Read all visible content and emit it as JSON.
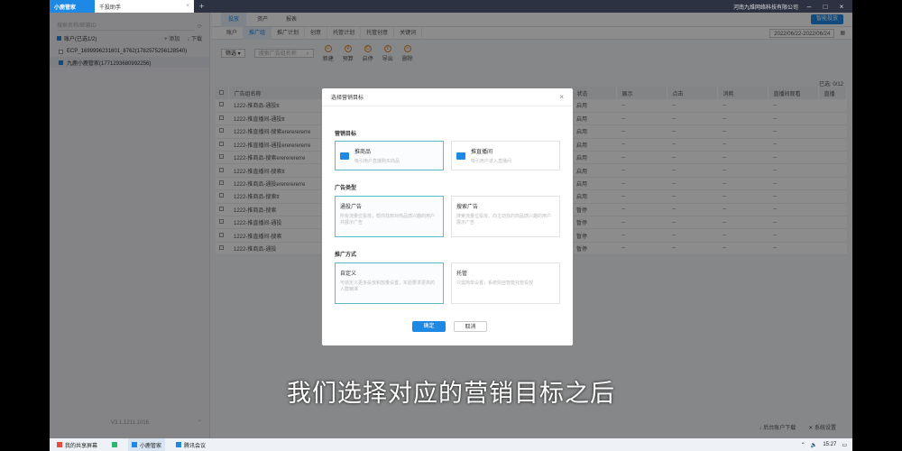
{
  "titlebar": {
    "app_tab": "小鹿管家",
    "doc_tab": "千投助手",
    "user": "河南九维网络科技有限公司",
    "close_icon": "×",
    "new_tab_icon": "+"
  },
  "left_panel": {
    "search_placeholder": "搜索名称/邮箱ID",
    "accounts_header": "账户(已选1/2)",
    "add_label": "添加",
    "download_label": "下载",
    "accounts": [
      "ECP_1699996231601_8762(1782575256128540)",
      "九鹿小鹿管家(1771293680992256)"
    ],
    "version": "V3.1.1211.1016"
  },
  "main": {
    "top_tabs": [
      "投放",
      "资产",
      "报表"
    ],
    "smart_button": "智能投放",
    "sub_tabs": [
      "账户",
      "推广组",
      "推广计划",
      "创意",
      "托管计划",
      "托管创意",
      "关键词"
    ],
    "date_range": "2022/06/22-2022/06/24",
    "filter_label": "筛选",
    "ad_search_placeholder": "搜索广告组名称",
    "tools": [
      "新建",
      "预算",
      "启停",
      "导出",
      "删除"
    ],
    "selected_count": "已选: 0/12",
    "columns": [
      "广告组名称",
      "状态",
      "展示",
      "点击",
      "消耗",
      "直播间观看",
      "直播"
    ],
    "rows": [
      [
        "1222-推商品-通投tt",
        "启用",
        "--",
        "--",
        "--",
        "--"
      ],
      [
        "1222-推直播间-通投tt",
        "启用",
        "--",
        "--",
        "--",
        "--"
      ],
      [
        "1222-推直播间-搜索erererererre",
        "启用",
        "--",
        "--",
        "--",
        "--"
      ],
      [
        "1222-推直播间-通投erererererre",
        "启用",
        "--",
        "--",
        "--",
        "--"
      ],
      [
        "1222-推商品-搜索erererererre",
        "启用",
        "--",
        "--",
        "--",
        "--"
      ],
      [
        "1222-推直播间-搜索tt",
        "启用",
        "--",
        "--",
        "--",
        "--"
      ],
      [
        "1222-推商品-通投erererererre",
        "启用",
        "--",
        "--",
        "--",
        "--"
      ],
      [
        "1222-推商品-搜索tt",
        "启用",
        "--",
        "--",
        "--",
        "--"
      ],
      [
        "1222-推商品-搜索",
        "暂停",
        "--",
        "--",
        "--",
        "--"
      ],
      [
        "1222-推直播间-通投",
        "暂停",
        "--",
        "--",
        "--",
        "--"
      ],
      [
        "1222-推直播间-搜索",
        "暂停",
        "--",
        "--",
        "--",
        "--"
      ],
      [
        "1222-推商品-通投",
        "暂停",
        "--",
        "--",
        "--",
        "--"
      ]
    ],
    "bottom_links": [
      "后台账户下载",
      "系统设置"
    ]
  },
  "modal": {
    "title": "选择营销目标",
    "close_icon": "×",
    "section_goal": "营销目标",
    "section_type": "广告类型",
    "section_method": "推广方式",
    "goal_cards": [
      {
        "title": "推商品",
        "desc": "吸引用户直接购买商品"
      },
      {
        "title": "推直播间",
        "desc": "吸引用户进入直播间"
      }
    ],
    "type_cards": [
      {
        "title": "通投广告",
        "desc": "所有流量位投放，帮你找到对商品感兴趣的用户并展示广告"
      },
      {
        "title": "搜索广告",
        "desc": "搜索流量位投放，向主动找的商品感兴趣的用户展示广告"
      }
    ],
    "method_cards": [
      {
        "title": "自定义",
        "desc": "可依定义更多投放和放量设置，实验要求更高的人群精准"
      },
      {
        "title": "托管",
        "desc": "只需简单设置，系统则自智能托管投放"
      }
    ],
    "ok_button": "确定",
    "cancel_button": "取消"
  },
  "subtitle": "我们选择对应的营销目标之后",
  "taskbar": {
    "items": [
      "我的共享屏幕",
      "小鹿管家",
      "腾讯会议"
    ],
    "time": "15:27"
  },
  "colors": {
    "accent": "#1e88e5",
    "selected_border": "#5bb9c8"
  }
}
